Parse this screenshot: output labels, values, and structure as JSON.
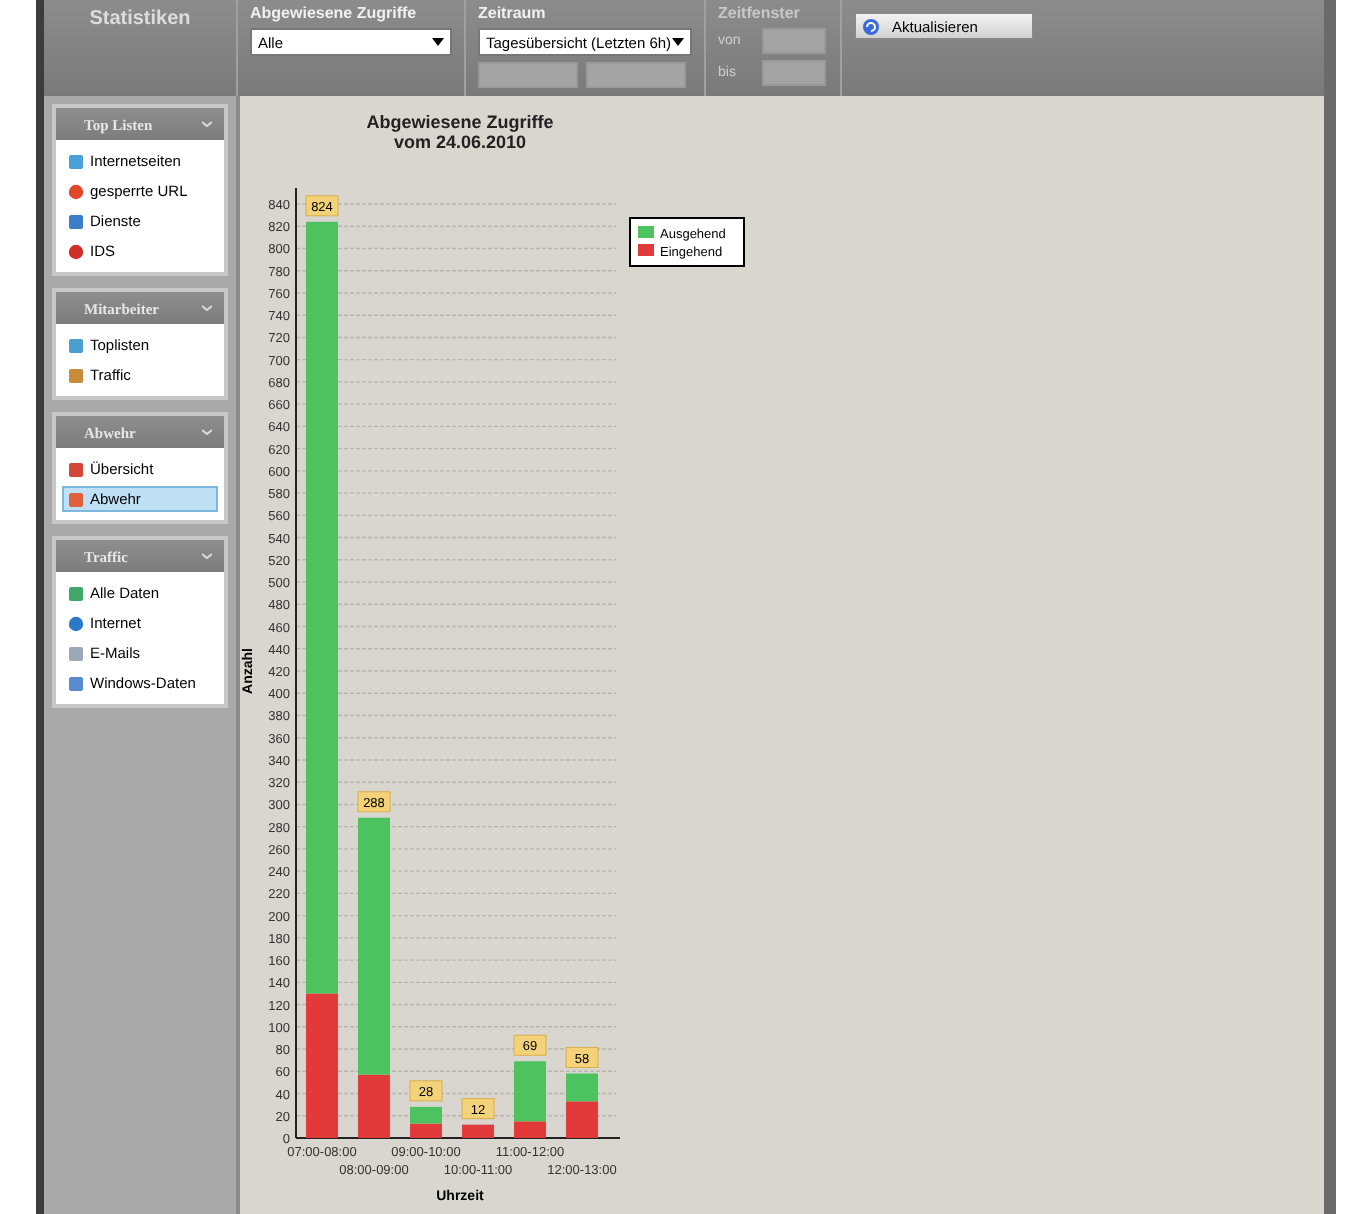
{
  "sidebar": {
    "title": "Statistiken",
    "groups": [
      {
        "title": "Top Listen",
        "items": [
          {
            "label": "Internetseiten",
            "selected": false
          },
          {
            "label": "gesperrte URL",
            "selected": false
          },
          {
            "label": "Dienste",
            "selected": false
          },
          {
            "label": "IDS",
            "selected": false
          }
        ]
      },
      {
        "title": "Mitarbeiter",
        "items": [
          {
            "label": "Toplisten",
            "selected": false
          },
          {
            "label": "Traffic",
            "selected": false
          }
        ]
      },
      {
        "title": "Abwehr",
        "items": [
          {
            "label": "Übersicht",
            "selected": false
          },
          {
            "label": "Abwehr",
            "selected": true
          }
        ]
      },
      {
        "title": "Traffic",
        "items": [
          {
            "label": "Alle Daten",
            "selected": false
          },
          {
            "label": "Internet",
            "selected": false
          },
          {
            "label": "E-Mails",
            "selected": false
          },
          {
            "label": "Windows-Daten",
            "selected": false
          }
        ]
      }
    ]
  },
  "toolbar": {
    "filter": {
      "label": "Abgewiesene Zugriffe",
      "value": "Alle"
    },
    "period": {
      "label": "Zeitraum",
      "value": "Tagesübersicht (Letzten 6h)"
    },
    "window": {
      "label": "Zeitfenster",
      "from": "von",
      "to": "bis",
      "disabled": true
    },
    "refresh": "Aktualisieren"
  },
  "chart_data": {
    "type": "bar",
    "title": "Abgewiesene Zugriffe\nvom 24.06.2010",
    "xlabel": "Uhrzeit",
    "ylabel": "Anzahl",
    "stacked": true,
    "categories": [
      "07:00-08:00",
      "08:00-09:00",
      "09:00-10:00",
      "10:00-11:00",
      "11:00-12:00",
      "12:00-13:00"
    ],
    "series": [
      {
        "name": "Ausgehend",
        "color": "#4cc35f",
        "values": [
          694,
          231,
          15,
          0,
          54,
          25
        ]
      },
      {
        "name": "Eingehend",
        "color": "#e23a3a",
        "values": [
          130,
          57,
          13,
          12,
          15,
          33
        ]
      }
    ],
    "value_labels": [
      "824",
      "288",
      "28",
      "12",
      "69",
      "58"
    ],
    "ylim": [
      0,
      840
    ],
    "grid": true,
    "legend": true,
    "yticks": [
      0,
      20,
      40,
      60,
      80,
      100,
      120,
      140,
      160,
      180,
      200,
      220,
      240,
      260,
      280,
      300,
      320,
      340,
      360,
      380,
      400,
      420,
      440,
      460,
      480,
      500,
      520,
      540,
      560,
      580,
      600,
      620,
      640,
      660,
      680,
      700,
      720,
      740,
      760,
      780,
      800,
      820,
      840
    ]
  }
}
